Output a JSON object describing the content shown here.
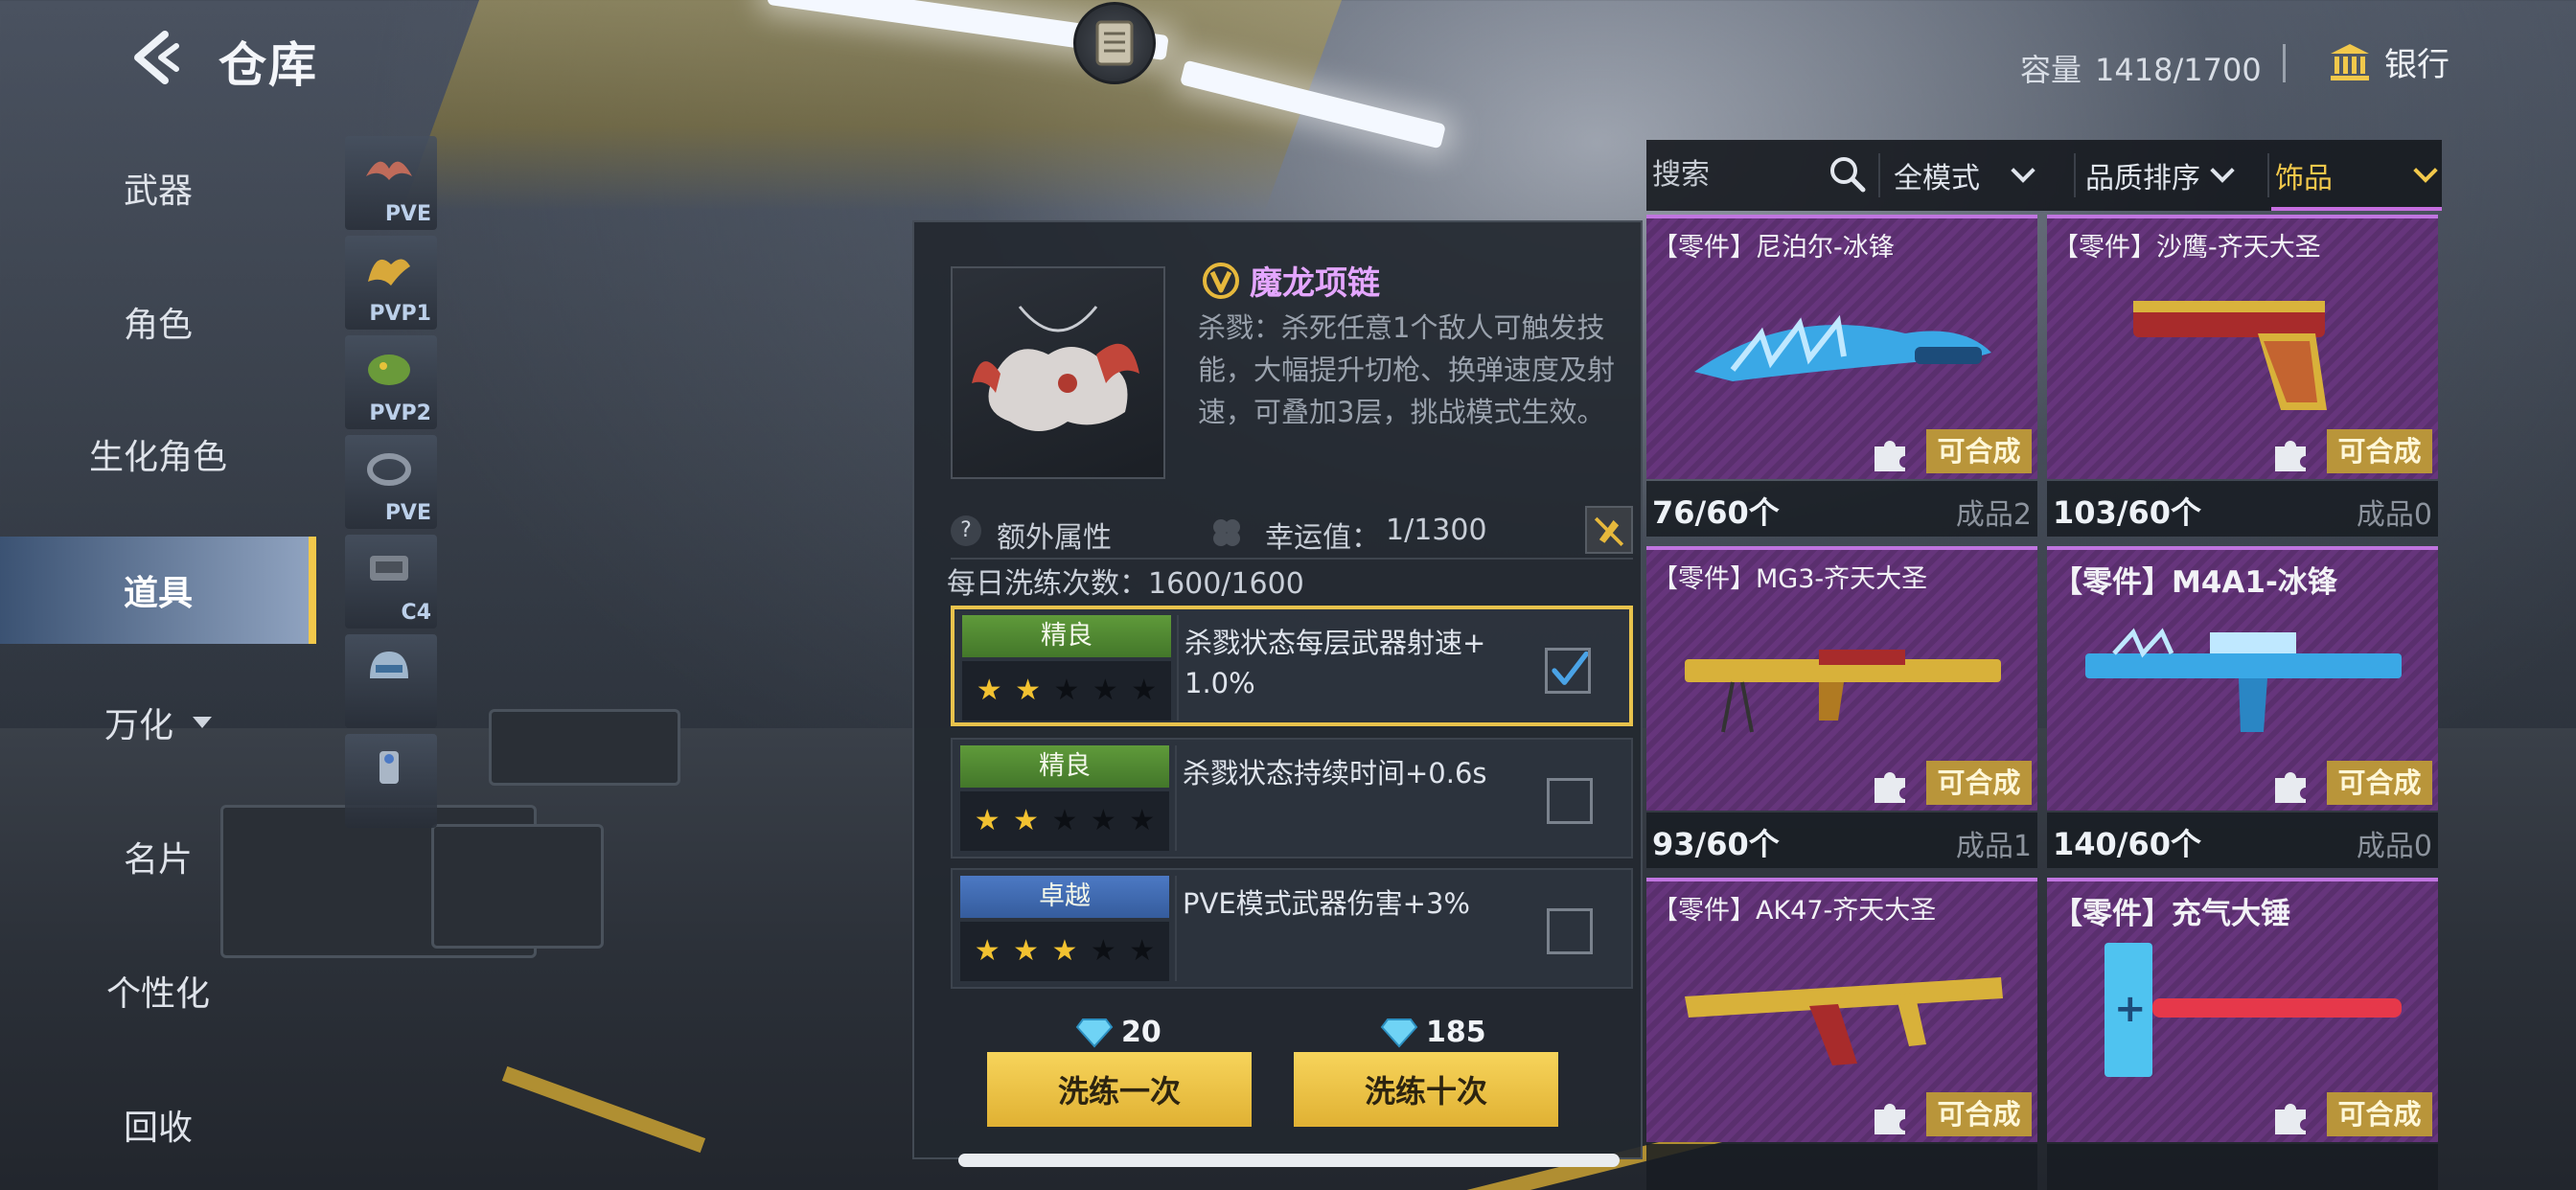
{
  "header": {
    "title": "仓库",
    "capacity_label": "容量",
    "capacity_value": "1418/1700",
    "bank_label": "银行"
  },
  "nav": {
    "items": [
      {
        "label": "武器"
      },
      {
        "label": "角色"
      },
      {
        "label": "生化角色"
      },
      {
        "label": "道具",
        "active": true
      },
      {
        "label": "万化"
      },
      {
        "label": "名片"
      },
      {
        "label": "个性化"
      },
      {
        "label": "回收"
      }
    ]
  },
  "subcategories": [
    {
      "tag": "PVE",
      "icon": "wings-icon"
    },
    {
      "tag": "PVP1",
      "icon": "golden-wings-icon"
    },
    {
      "tag": "PVP2",
      "icon": "dragon-icon"
    },
    {
      "tag": "PVE",
      "icon": "ring-icon"
    },
    {
      "tag": "C4",
      "icon": "c4-icon"
    },
    {
      "tag": "",
      "icon": "helmet-icon"
    },
    {
      "tag": "",
      "icon": "gear-figure-icon"
    }
  ],
  "detail": {
    "name": "魔龙项链",
    "description": "杀戮：杀死任意1个敌人可触发技能，大幅提升切枪、换弹速度及射速，可叠加3层，挑战模式生效。",
    "extra_attr_label": "额外属性",
    "luck_label": "幸运值：",
    "luck_value": "1/1300",
    "wash_count": "每日洗练次数：1600/1600",
    "attributes": [
      {
        "rank": "精良",
        "stars": 2,
        "text": "杀戮状态每层武器射速+1.0%",
        "checked": true
      },
      {
        "rank": "精良",
        "stars": 2,
        "text": "杀戮状态持续时间+0.6s",
        "checked": false
      },
      {
        "rank": "卓越",
        "stars": 3,
        "text": "PVE模式武器伤害+3%",
        "checked": false
      }
    ],
    "cost_once": "20",
    "cost_ten": "185",
    "wash_once_label": "洗练一次",
    "wash_ten_label": "洗练十次"
  },
  "filters": {
    "search_placeholder": "搜索",
    "mode": "全模式",
    "sort": "品质排序",
    "category": "饰品"
  },
  "items": [
    {
      "title": "【零件】尼泊尔-冰锋",
      "badge": "可合成",
      "count": "76/60个",
      "made": "成品2",
      "img": "ice-knife"
    },
    {
      "title": "【零件】沙鹰-齐天大圣",
      "badge": "可合成",
      "count": "103/60个",
      "made": "成品0",
      "img": "deagle"
    },
    {
      "title": "【零件】MG3-齐天大圣",
      "badge": "可合成",
      "count": "93/60个",
      "made": "成品1",
      "img": "mg3"
    },
    {
      "title": "【零件】M4A1-冰锋",
      "badge": "可合成",
      "count": "140/60个",
      "made": "成品0",
      "img": "m4a1"
    },
    {
      "title": "【零件】AK47-齐天大圣",
      "badge": "可合成",
      "count": "",
      "made": "",
      "img": "ak47"
    },
    {
      "title": "【零件】充气大锤",
      "badge": "可合成",
      "count": "",
      "made": "",
      "img": "hammer"
    }
  ]
}
